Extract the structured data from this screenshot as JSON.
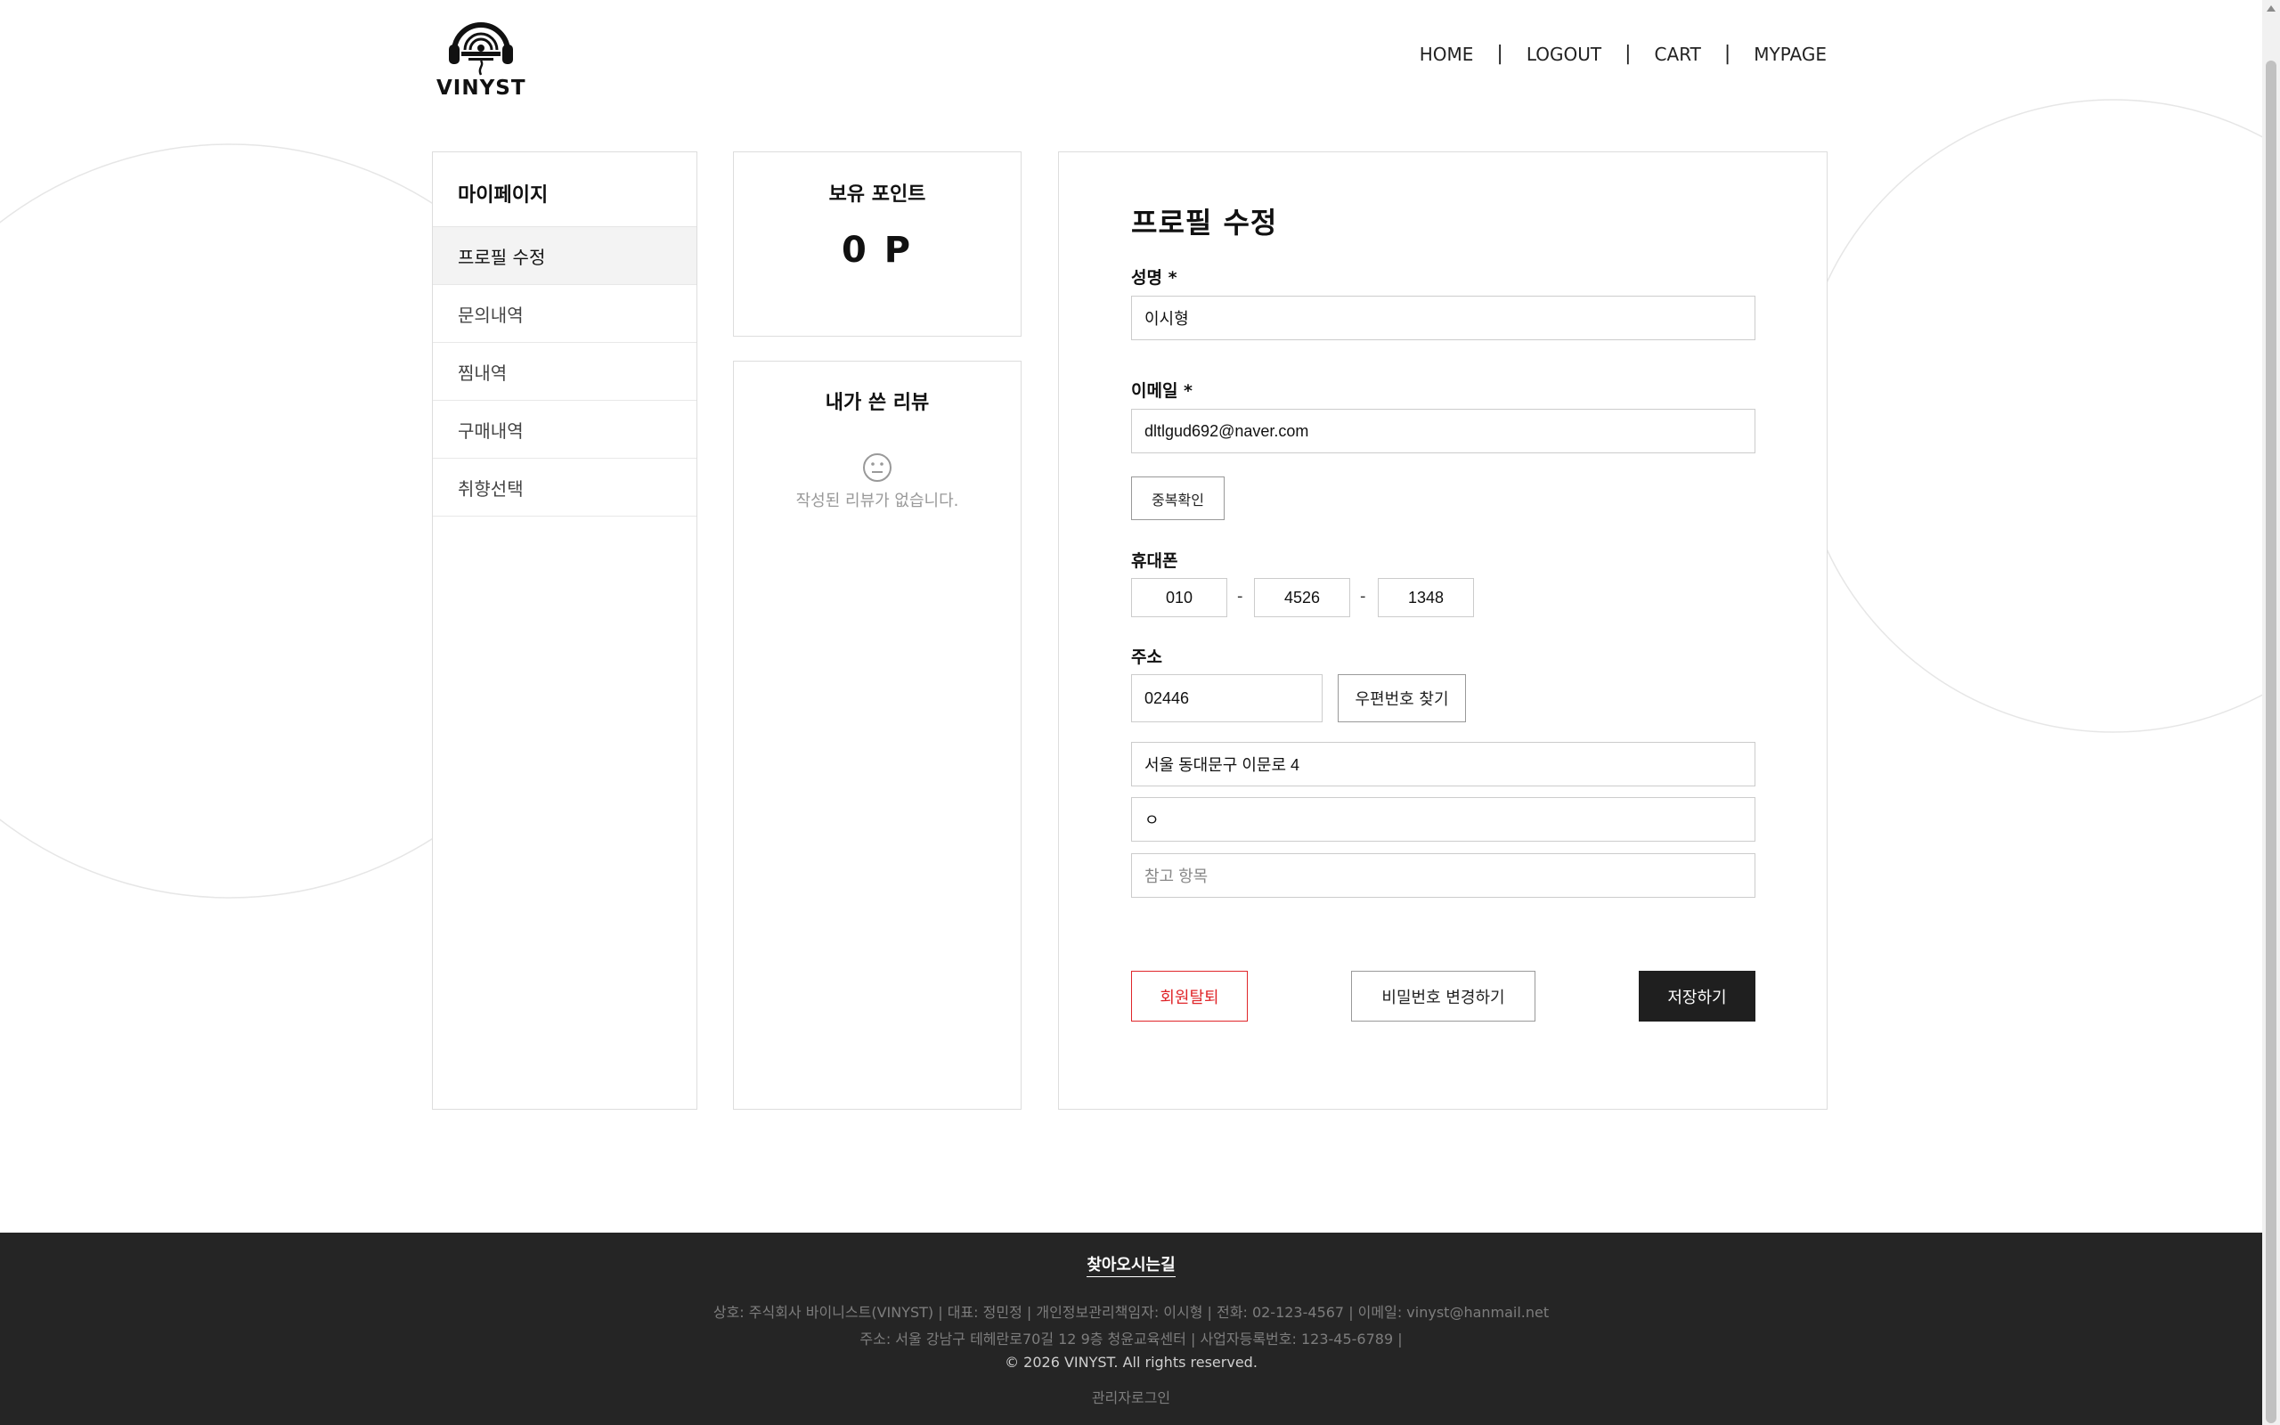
{
  "brand": {
    "name": "VINYST"
  },
  "nav": {
    "home": "HOME",
    "logout": "LOGOUT",
    "cart": "CART",
    "mypage": "MYPAGE",
    "separator": "|"
  },
  "sidebar": {
    "title": "마이페이지",
    "items": [
      {
        "label": "프로필 수정",
        "active": true
      },
      {
        "label": "문의내역"
      },
      {
        "label": "찜내역"
      },
      {
        "label": "구매내역"
      },
      {
        "label": "취향선택"
      }
    ]
  },
  "points": {
    "title": "보유 포인트",
    "value": "0 P"
  },
  "reviews": {
    "title": "내가 쓴 리뷰",
    "icon": "neutral-face-icon",
    "empty_text": "작성된 리뷰가 없습니다."
  },
  "profile": {
    "title": "프로필 수정",
    "name_label": "성명 *",
    "name_value": "이시형",
    "email_label": "이메일 *",
    "email_value": "dltlgud692@naver.com",
    "dup_check_label": "중복확인",
    "phone_label": "휴대폰",
    "phone": [
      "010",
      "4526",
      "1348"
    ],
    "phone_separator": "-",
    "address_label": "주소",
    "postcode": "02446",
    "find_postcode_label": "우편번호 찾기",
    "address1": "서울 동대문구 이문로 4",
    "address2": "ㅇ",
    "reference_placeholder": "참고 항목",
    "withdraw_label": "회원탈퇴",
    "change_password_label": "비밀번호 변경하기",
    "save_label": "저장하기"
  },
  "footer": {
    "find_label": "찾아오시는길",
    "line1": "상호: 주식회사 바이니스트(VINYST) | 대표: 정민정 | 개인정보관리책임자: 이시형 | 전화: 02-123-4567 | 이메일: vinyst@hanmail.net",
    "line2": "주소: 서울 강남구 테헤란로70길 12 9층 청윤교육센터 | 사업자등록번호: 123-45-6789 |",
    "copyright": "© 2026 VINYST. All rights reserved.",
    "admin_login": "관리자로그인"
  },
  "colors": {
    "accent_dark": "#1f1f1f",
    "danger": "#e0262a",
    "footer_bg": "#252525"
  }
}
